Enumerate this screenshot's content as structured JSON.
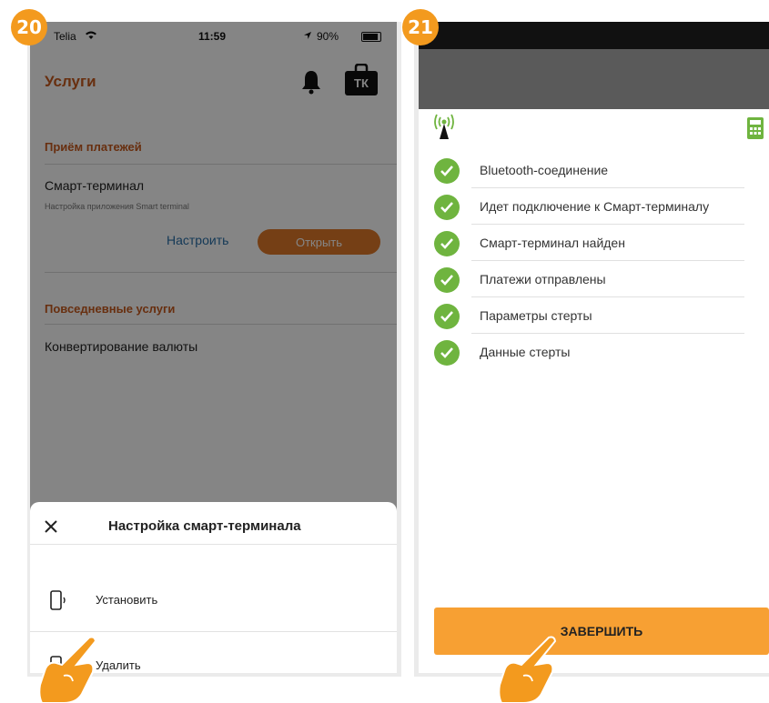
{
  "badges": {
    "left": "20",
    "right": "21"
  },
  "left_screen": {
    "status_bar": {
      "carrier": "Telia",
      "time": "11:59",
      "battery": "90%"
    },
    "header": {
      "title": "Услуги",
      "bell_icon": "bell-icon",
      "tk_label": "ТК"
    },
    "payments_section": {
      "title": "Приём платежей",
      "item_title": "Смарт-терминал",
      "item_subtitle": "Настройка приложения Smart terminal",
      "configure_label": "Настроить",
      "open_label": "Открыть"
    },
    "daily_section": {
      "title": "Повседневные услуги",
      "item_title": "Конвертирование валюты"
    },
    "sheet": {
      "title": "Настройка смарт-терминала",
      "items": [
        {
          "label": "Установить",
          "icon": "phone-signal-icon"
        },
        {
          "label": "Удалить",
          "icon": "phone-delete-icon"
        }
      ]
    }
  },
  "right_screen": {
    "steps": [
      {
        "label": "Bluetooth-соединение"
      },
      {
        "label": "Идет подключение к Смарт-терминалу"
      },
      {
        "label": "Смарт-терминал найден"
      },
      {
        "label": "Платежи отправлены"
      },
      {
        "label": "Параметры стерты"
      },
      {
        "label": "Данные стерты"
      }
    ],
    "finish_button": "ЗАВЕРШИТЬ"
  },
  "colors": {
    "accent_orange": "#f39a1e",
    "brand_brown": "#c85a1e",
    "check_green": "#6fb43f",
    "finish_button": "#f7a033"
  }
}
